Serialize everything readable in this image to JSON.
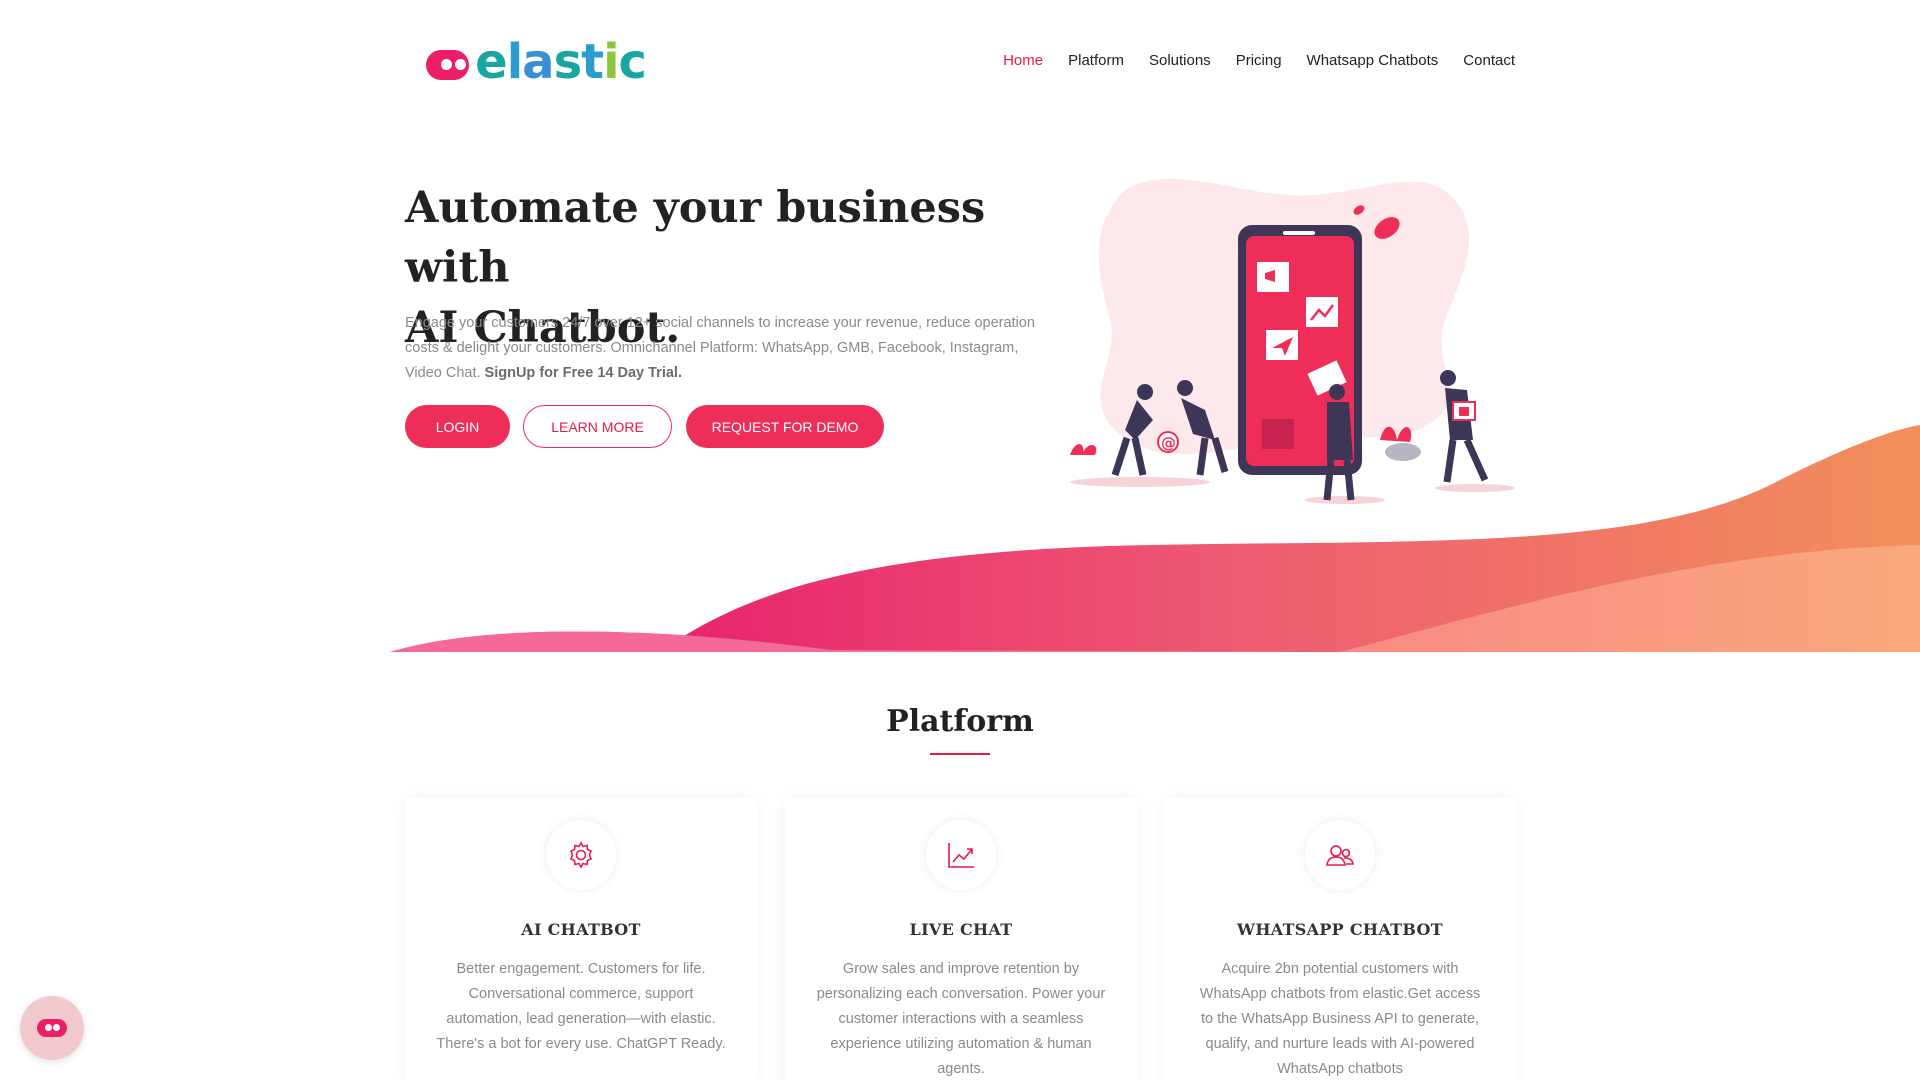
{
  "brand": {
    "name": "elastic",
    "primary_color": "#ee2e58",
    "logo_colors": [
      "#ec1e6a",
      "#1aa6a0",
      "#2b9bd0",
      "#8cc63f"
    ]
  },
  "nav": {
    "items": [
      {
        "label": "Home",
        "active": true
      },
      {
        "label": "Platform",
        "active": false
      },
      {
        "label": "Solutions",
        "active": false
      },
      {
        "label": "Pricing",
        "active": false
      },
      {
        "label": "Whatsapp Chatbots",
        "active": false
      },
      {
        "label": "Contact",
        "active": false
      }
    ]
  },
  "hero": {
    "title_line1": "Automate your business with",
    "title_line2": "AI Chatbot.",
    "description": "Engage your customers 24/7 over 12+ social channels to increase your revenue, reduce operation costs & delight your customers. Omnichannel Platform: WhatsApp, GMB, Facebook, Instagram, Video Chat.",
    "description_emphasis": "SignUp for Free 14 Day Trial.",
    "buttons": {
      "login": "LOGIN",
      "learn_more": "LEARN MORE",
      "demo": "REQUEST FOR DEMO"
    }
  },
  "platform": {
    "title": "Platform",
    "cards": [
      {
        "icon": "gear-icon",
        "title": "AI CHATBOT",
        "description": "Better engagement. Customers for life. Conversational commerce, support automation, lead generation—with elastic. There's a bot for every use. ChatGPT Ready."
      },
      {
        "icon": "chart-line-icon",
        "title": "LIVE CHAT",
        "description": "Grow sales and improve retention by personalizing each conversation. Power your customer interactions with a seamless experience utilizing automation & human agents."
      },
      {
        "icon": "users-icon",
        "title": "WHATSAPP CHATBOT",
        "description": "Acquire 2bn potential customers with WhatsApp chatbots from elastic.Get access to the WhatsApp Business API to generate, qualify, and nurture leads with AI-powered WhatsApp chatbots"
      }
    ]
  },
  "chat_widget": {
    "icon": "chatbot-icon"
  }
}
